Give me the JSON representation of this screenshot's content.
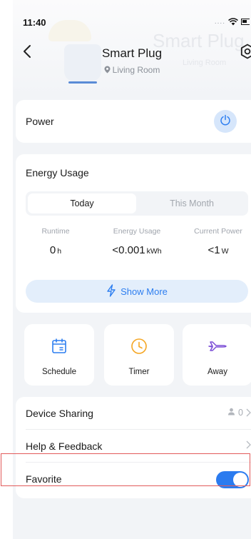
{
  "status_bar": {
    "time": "11:40",
    "signal_dots": "...."
  },
  "header": {
    "title": "Smart Plug",
    "location": "Living Room",
    "watermark_title": "Smart Plug",
    "watermark_location": "Living Room"
  },
  "power": {
    "label": "Power",
    "state": "off"
  },
  "energy": {
    "title": "Energy Usage",
    "tabs": [
      {
        "label": "Today",
        "active": true
      },
      {
        "label": "This Month",
        "active": false
      }
    ],
    "stats": [
      {
        "label": "Runtime",
        "value": "0",
        "unit": "h"
      },
      {
        "label": "Energy Usage",
        "value": "<0.001",
        "unit": "kWh"
      },
      {
        "label": "Current Power",
        "value": "<1",
        "unit": "W"
      }
    ],
    "show_more_label": "Show More"
  },
  "features": [
    {
      "label": "Schedule",
      "icon": "calendar-icon",
      "color": "#2d7ef0"
    },
    {
      "label": "Timer",
      "icon": "clock-icon",
      "color": "#f5a623"
    },
    {
      "label": "Away",
      "icon": "airplane-icon",
      "color": "#7b4dd6"
    }
  ],
  "settings_list": {
    "device_sharing": {
      "label": "Device Sharing",
      "count": "0"
    },
    "help": {
      "label": "Help & Feedback"
    },
    "favorite": {
      "label": "Favorite",
      "enabled": true
    }
  },
  "colors": {
    "accent": "#2b7bef",
    "highlight_border": "#e25a5a"
  }
}
